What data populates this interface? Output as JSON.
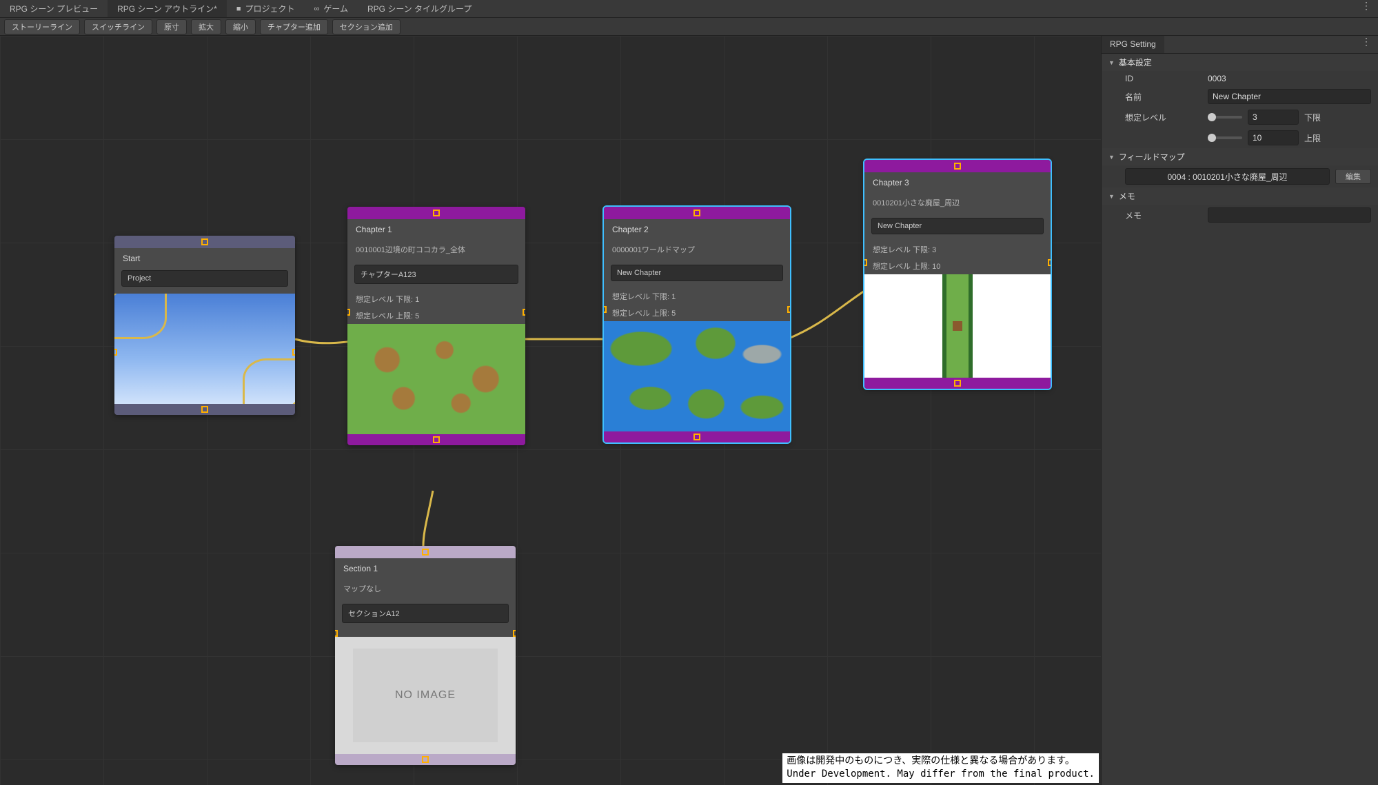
{
  "tabs": [
    {
      "label": "RPG シーン プレビュー"
    },
    {
      "label": "RPG シーン アウトライン*",
      "active": true
    },
    {
      "label": "プロジェクト",
      "icon": "folder"
    },
    {
      "label": "ゲーム",
      "icon": "inf"
    },
    {
      "label": "RPG シーン タイルグループ"
    }
  ],
  "toolbar": [
    "ストーリーライン",
    "スイッチライン",
    "原寸",
    "拡大",
    "縮小",
    "チャプター追加",
    "セクション追加"
  ],
  "nodes": {
    "start": {
      "title": "Start",
      "field": "Project"
    },
    "ch1": {
      "title": "Chapter 1",
      "sub": "0010001辺境の町ココカラ_全体",
      "field": "チャプターA123",
      "lvl_lo": "想定レベル 下限: 1",
      "lvl_hi": "想定レベル 上限: 5"
    },
    "ch2": {
      "title": "Chapter 2",
      "sub": "0000001ワールドマップ",
      "field": "New Chapter",
      "lvl_lo": "想定レベル 下限: 1",
      "lvl_hi": "想定レベル 上限: 5"
    },
    "ch3": {
      "title": "Chapter 3",
      "sub": "0010201小さな廃屋_周辺",
      "field": "New Chapter",
      "lvl_lo": "想定レベル 下限: 3",
      "lvl_hi": "想定レベル 上限: 10"
    },
    "sec1": {
      "title": "Section 1",
      "sub": "マップなし",
      "field": "セクションA12",
      "noimg": "NO IMAGE"
    }
  },
  "inspector": {
    "tab": "RPG Setting",
    "sec_basic": "基本設定",
    "id_label": "ID",
    "id_value": "0003",
    "name_label": "名前",
    "name_value": "New Chapter",
    "level_label": "想定レベル",
    "level_lo": "3",
    "level_lo_suffix": "下限",
    "level_hi": "10",
    "level_hi_suffix": "上限",
    "sec_field": "フィールドマップ",
    "field_value": "0004 : 0010201小さな廃屋_周辺",
    "edit_btn": "編集",
    "sec_memo": "メモ",
    "memo_label": "メモ"
  },
  "dev_note": "画像は開発中のものにつき、実際の仕様と異なる場合があります。\nUnder Development. May differ from the final product."
}
